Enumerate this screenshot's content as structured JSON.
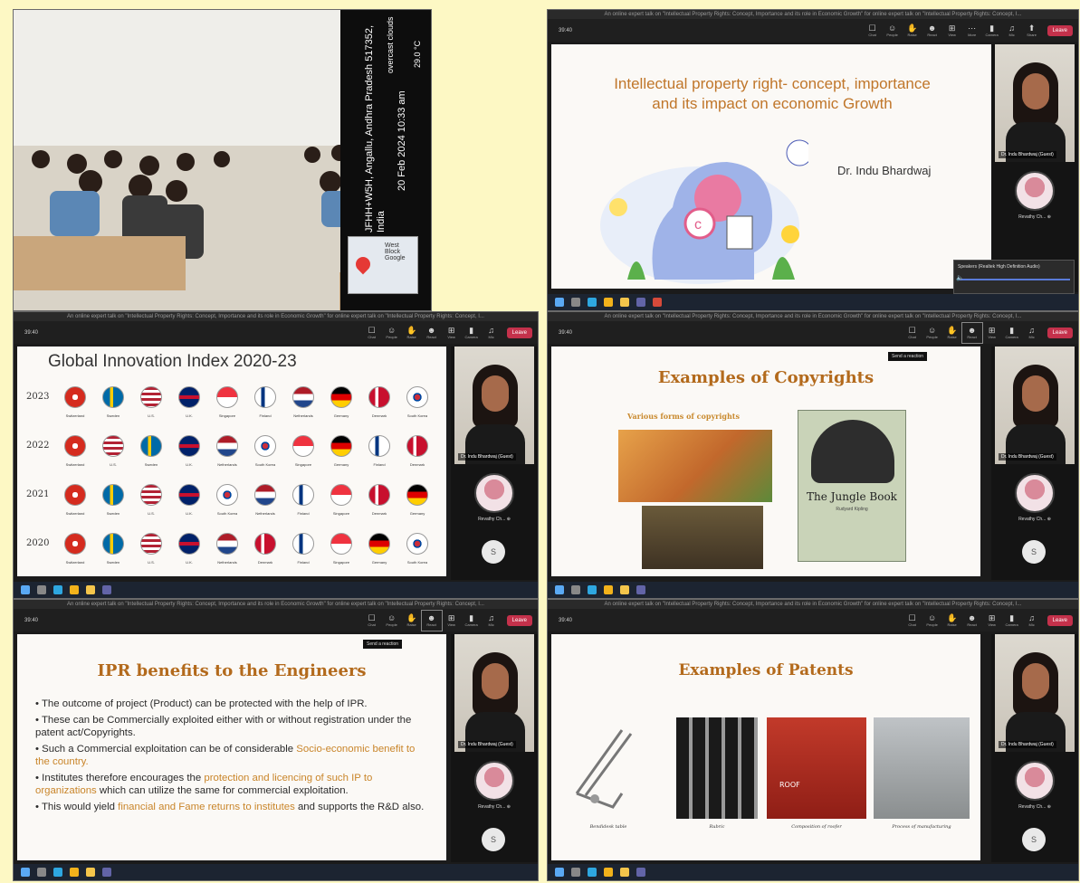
{
  "photo": {
    "overlay_location": "JFHH+W5H, Angallu, Andhra Pradesh 517352, India",
    "overlay_datetime": "20 Feb 2024 10:33 am",
    "overlay_weather": "overcast clouds",
    "overlay_temp": "29.0 °C",
    "map_brand": "West Block Google"
  },
  "meeting_window": {
    "title": "An online expert talk on \"Intellectual Property Rights: Concept, Importance and its role in Economic Growth\" for online expert talk on \"Intellectual Property Rights: Concept, I...",
    "clock": "39:40",
    "toolbar": [
      {
        "name": "chat",
        "glyph": "☐",
        "label": "Chat"
      },
      {
        "name": "people",
        "glyph": "☺",
        "label": "People"
      },
      {
        "name": "raise",
        "glyph": "✋",
        "label": "Raise"
      },
      {
        "name": "react",
        "glyph": "☻",
        "label": "React"
      },
      {
        "name": "view",
        "glyph": "⊞",
        "label": "View"
      },
      {
        "name": "more",
        "glyph": "⋯",
        "label": "More"
      },
      {
        "name": "camera",
        "glyph": "▮",
        "label": "Camera"
      },
      {
        "name": "mic",
        "glyph": "♫",
        "label": "Mic"
      },
      {
        "name": "share",
        "glyph": "⬆",
        "label": "Share"
      }
    ],
    "leave_label": "Leave",
    "send_reaction_tooltip": "Send a reaction",
    "presenter_name": "Dr. Indu Bhardwaj (Guest)",
    "attendee_name": "Revathy Ch... ⊕",
    "attendee_initial": "S",
    "speaker_notice": "Speakers (Realtek High Definition Audio)"
  },
  "slides": {
    "title_slide": {
      "title_line1": "Intellectual property right- concept, importance",
      "title_line2": "and its impact on economic Growth",
      "author": "Dr. Indu Bhardwaj"
    },
    "gii": {
      "title": "Global Innovation Index 2020-23",
      "rows": [
        {
          "year": "2023",
          "countries": [
            "Switzerland",
            "Sweden",
            "U.S.",
            "U.K.",
            "Singapore",
            "Finland",
            "Netherlands",
            "Germany",
            "Denmark",
            "South Korea"
          ]
        },
        {
          "year": "2022",
          "countries": [
            "Switzerland",
            "U.S.",
            "Sweden",
            "U.K.",
            "Netherlands",
            "South Korea",
            "Singapore",
            "Germany",
            "Finland",
            "Denmark"
          ]
        },
        {
          "year": "2021",
          "countries": [
            "Switzerland",
            "Sweden",
            "U.S.",
            "U.K.",
            "South Korea",
            "Netherlands",
            "Finland",
            "Singapore",
            "Denmark",
            "Germany"
          ]
        },
        {
          "year": "2020",
          "countries": [
            "Switzerland",
            "Sweden",
            "U.S.",
            "U.K.",
            "Netherlands",
            "Denmark",
            "Finland",
            "Singapore",
            "Germany",
            "South Korea"
          ]
        }
      ]
    },
    "copyrights": {
      "title": "Examples of Copyrights",
      "subtitle": "Various forms of copyrights",
      "book_title": "The Jungle Book",
      "book_author": "Rudyard Kipling"
    },
    "ipr": {
      "title": "IPR benefits to the Engineers",
      "b1": "The outcome of project (Product) can be protected with the help of IPR.",
      "b2": "These can be Commercially exploited either with or without registration under the patent act/Copyrights.",
      "b3a": "Such a Commercial exploitation can be of considerable ",
      "b3b": "Socio-economic benefit to the country.",
      "b4a": "Institutes therefore encourages the ",
      "b4b": "protection and licencing of such IP to organizations",
      "b4c": " which can utilize the same for commercial exploitation.",
      "b5a": "This would yield ",
      "b5b": "financial and Fame returns to institutes",
      "b5c": " and supports the R&D also."
    },
    "patents": {
      "title": "Examples of Patents",
      "captions": [
        "Bendidesk table",
        "Rubric",
        "Composition of roofer",
        "Process of manufacturing"
      ]
    }
  },
  "colors": {
    "slide_title": "#b36a1c",
    "highlight": "#c9852a",
    "page_bg": "#fdf8c4"
  }
}
